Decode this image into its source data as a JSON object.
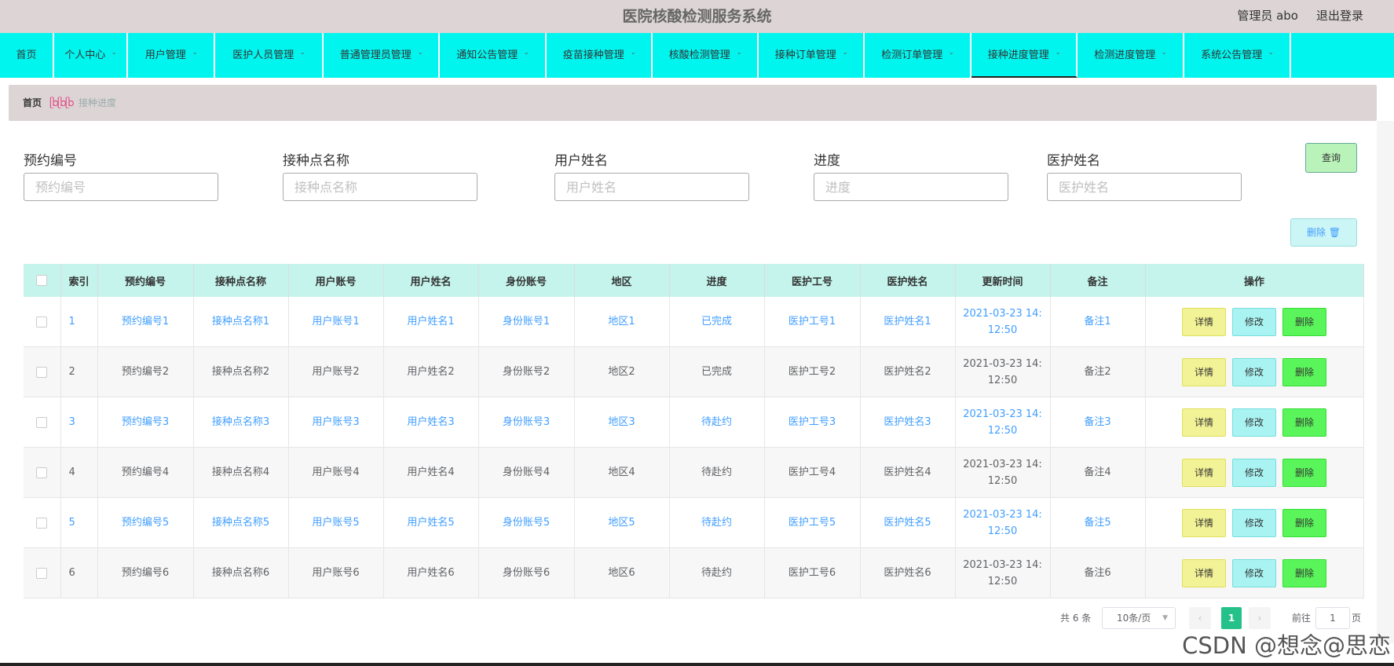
{
  "header": {
    "title": "医院核酸检测服务系统",
    "admin": "管理员 abo",
    "logout": "退出登录"
  },
  "nav": [
    {
      "label": "首页",
      "dropdown": false
    },
    {
      "label": "个人中心",
      "dropdown": true
    },
    {
      "label": "用户管理",
      "dropdown": true
    },
    {
      "label": "医护人员管理",
      "dropdown": true
    },
    {
      "label": "普通管理员管理",
      "dropdown": true
    },
    {
      "label": "通知公告管理",
      "dropdown": true
    },
    {
      "label": "疫苗接种管理",
      "dropdown": true
    },
    {
      "label": "核酸检测管理",
      "dropdown": true
    },
    {
      "label": "接种订单管理",
      "dropdown": true
    },
    {
      "label": "检测订单管理",
      "dropdown": true
    },
    {
      "label": "接种进度管理",
      "dropdown": true,
      "active": true
    },
    {
      "label": "检测进度管理",
      "dropdown": true
    },
    {
      "label": "系统公告管理",
      "dropdown": true
    }
  ],
  "breadcrumb": {
    "home": "首页",
    "separator": "ᥫᩣᥫᩣᥫᩣ",
    "current": "接种进度"
  },
  "search": {
    "fields": [
      {
        "label": "预约编号",
        "placeholder": "预约编号"
      },
      {
        "label": "接种点名称",
        "placeholder": "接种点名称"
      },
      {
        "label": "用户姓名",
        "placeholder": "用户姓名"
      },
      {
        "label": "进度",
        "placeholder": "进度"
      },
      {
        "label": "医护姓名",
        "placeholder": "医护姓名"
      }
    ],
    "query_button": "查询",
    "delete_button": "删除 🗑"
  },
  "table": {
    "headers": [
      "索引",
      "预约编号",
      "接种点名称",
      "用户账号",
      "用户姓名",
      "身份账号",
      "地区",
      "进度",
      "医护工号",
      "医护姓名",
      "更新时间",
      "备注",
      "操作"
    ],
    "rows": [
      [
        "1",
        "预约编号1",
        "接种点名称1",
        "用户账号1",
        "用户姓名1",
        "身份账号1",
        "地区1",
        "已完成",
        "医护工号1",
        "医护姓名1",
        "2021-03-23 14:\n12:50",
        "备注1"
      ],
      [
        "2",
        "预约编号2",
        "接种点名称2",
        "用户账号2",
        "用户姓名2",
        "身份账号2",
        "地区2",
        "已完成",
        "医护工号2",
        "医护姓名2",
        "2021-03-23 14:\n12:50",
        "备注2"
      ],
      [
        "3",
        "预约编号3",
        "接种点名称3",
        "用户账号3",
        "用户姓名3",
        "身份账号3",
        "地区3",
        "待赴约",
        "医护工号3",
        "医护姓名3",
        "2021-03-23 14:\n12:50",
        "备注3"
      ],
      [
        "4",
        "预约编号4",
        "接种点名称4",
        "用户账号4",
        "用户姓名4",
        "身份账号4",
        "地区4",
        "待赴约",
        "医护工号4",
        "医护姓名4",
        "2021-03-23 14:\n12:50",
        "备注4"
      ],
      [
        "5",
        "预约编号5",
        "接种点名称5",
        "用户账号5",
        "用户姓名5",
        "身份账号5",
        "地区5",
        "待赴约",
        "医护工号5",
        "医护姓名5",
        "2021-03-23 14:\n12:50",
        "备注5"
      ],
      [
        "6",
        "预约编号6",
        "接种点名称6",
        "用户账号6",
        "用户姓名6",
        "身份账号6",
        "地区6",
        "待赴约",
        "医护工号6",
        "医护姓名6",
        "2021-03-23 14:\n12:50",
        "备注6"
      ]
    ],
    "actions": {
      "detail": "详情",
      "edit": "修改",
      "delete": "删除"
    }
  },
  "pagination": {
    "total": "共 6 条",
    "page_size": "10条/页",
    "current_page": "1",
    "goto_label": "前往",
    "goto_value": "1",
    "page_unit": "页"
  },
  "watermark": "CSDN @想念@思恋",
  "colors": {
    "header_bg": "#ddd5d5",
    "nav_bg": "#00f5ef",
    "table_header_bg": "#c4f4ec",
    "link_blue": "#409eff",
    "page_active": "#25c18a"
  }
}
